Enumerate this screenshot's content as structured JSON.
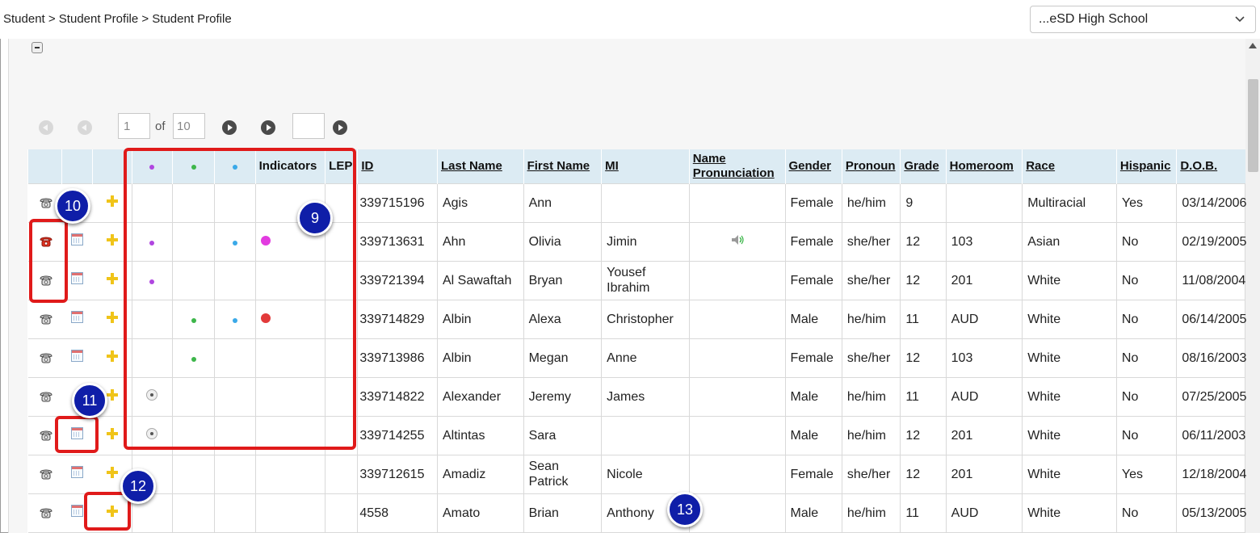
{
  "breadcrumb": "Student > Student Profile > Student Profile",
  "school_select": {
    "value": "...eSD High School"
  },
  "pager": {
    "current_page": "1",
    "of_label": "of",
    "total_pages": "10",
    "goto_value": ""
  },
  "columns": {
    "indicators": "Indicators",
    "lep": "LEP",
    "id": "ID",
    "last_name": "Last Name",
    "first_name": "First Name",
    "mi": "MI",
    "name_pronunciation": "Name Pronunciation",
    "gender": "Gender",
    "pronoun": "Pronoun",
    "grade": "Grade",
    "homeroom": "Homeroom",
    "race": "Race",
    "hispanic": "Hispanic",
    "dob": "D.O.B."
  },
  "rows": [
    {
      "id": "339715196",
      "last": "Agis",
      "first": "Ann",
      "mi": "",
      "gender": "Female",
      "pronoun": "he/him",
      "grade": "9",
      "homeroom": "",
      "race": "Multiracial",
      "hispanic": "Yes",
      "dob": "03/14/2006"
    },
    {
      "id": "339713631",
      "last": "Ahn",
      "first": "Olivia",
      "mi": "Jimin",
      "gender": "Female",
      "pronoun": "she/her",
      "grade": "12",
      "homeroom": "103",
      "race": "Asian",
      "hispanic": "No",
      "dob": "02/19/2005"
    },
    {
      "id": "339721394",
      "last": "Al Sawaftah",
      "first": "Bryan",
      "mi": "Yousef Ibrahim",
      "gender": "Female",
      "pronoun": "she/her",
      "grade": "12",
      "homeroom": "201",
      "race": "White",
      "hispanic": "No",
      "dob": "11/08/2004"
    },
    {
      "id": "339714829",
      "last": "Albin",
      "first": "Alexa",
      "mi": "Christopher",
      "gender": "Male",
      "pronoun": "he/him",
      "grade": "11",
      "homeroom": "AUD",
      "race": "White",
      "hispanic": "No",
      "dob": "06/14/2005"
    },
    {
      "id": "339713986",
      "last": "Albin",
      "first": "Megan",
      "mi": "Anne",
      "gender": "Female",
      "pronoun": "she/her",
      "grade": "12",
      "homeroom": "103",
      "race": "White",
      "hispanic": "No",
      "dob": "08/16/2003"
    },
    {
      "id": "339714822",
      "last": "Alexander",
      "first": "Jeremy",
      "mi": "James",
      "gender": "Male",
      "pronoun": "he/him",
      "grade": "11",
      "homeroom": "AUD",
      "race": "White",
      "hispanic": "No",
      "dob": "07/25/2005"
    },
    {
      "id": "339714255",
      "last": "Altintas",
      "first": "Sara",
      "mi": "",
      "gender": "Male",
      "pronoun": "he/him",
      "grade": "12",
      "homeroom": "201",
      "race": "White",
      "hispanic": "No",
      "dob": "06/11/2003"
    },
    {
      "id": "339712615",
      "last": "Amadiz",
      "first": "Sean Patrick",
      "mi": "Nicole",
      "gender": "Female",
      "pronoun": "she/her",
      "grade": "12",
      "homeroom": "201",
      "race": "White",
      "hispanic": "Yes",
      "dob": "12/18/2004"
    },
    {
      "id": "4558",
      "last": "Amato",
      "first": "Brian",
      "mi": "Anthony",
      "gender": "Male",
      "pronoun": "he/him",
      "grade": "11",
      "homeroom": "AUD",
      "race": "White",
      "hispanic": "No",
      "dob": "05/13/2005"
    }
  ],
  "callouts": {
    "c9": "9",
    "c10": "10",
    "c11": "11",
    "c12": "12",
    "c13": "13"
  },
  "colors": {
    "header_bg": "#dcebf3",
    "highlight": "#e01a1a",
    "badge": "#0f1ea8",
    "indicator_purple": "#b046e0",
    "indicator_green": "#3db64a",
    "indicator_blue": "#3aa9e8",
    "indicator_magenta": "#e23be0",
    "indicator_red": "#e23a3a"
  }
}
